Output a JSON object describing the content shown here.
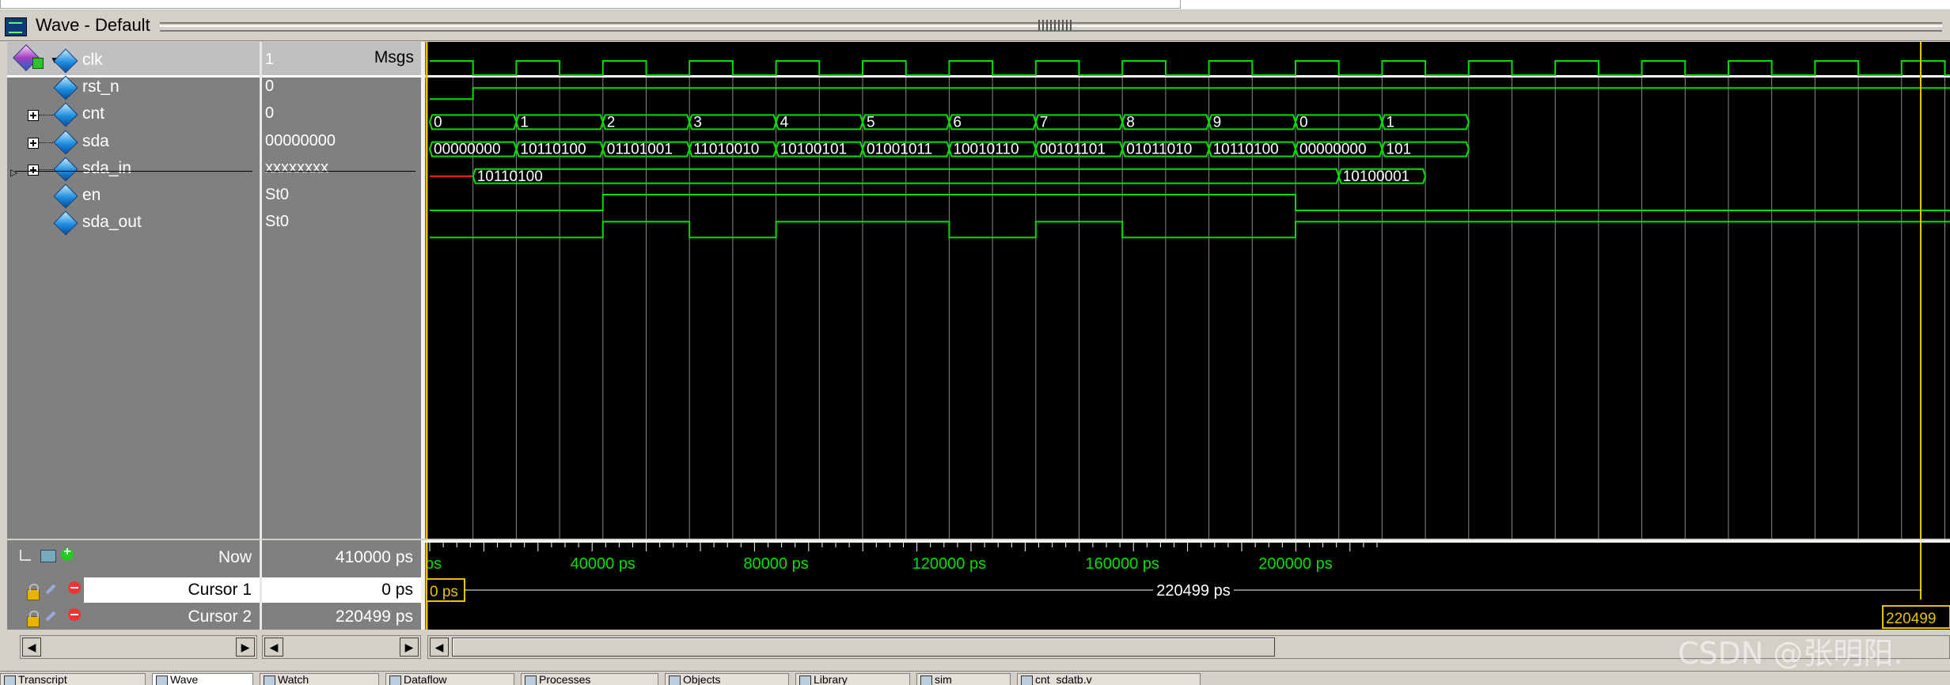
{
  "window": {
    "title": "Wave - Default"
  },
  "columns": {
    "msgs": "Msgs"
  },
  "signals": [
    {
      "name": "clk",
      "value": "1",
      "expandable": false
    },
    {
      "name": "rst_n",
      "value": "0",
      "expandable": false
    },
    {
      "name": "cnt",
      "value": "0",
      "expandable": true
    },
    {
      "name": "sda",
      "value": "00000000",
      "expandable": true
    },
    {
      "name": "sda_in",
      "value": "xxxxxxxx",
      "expandable": true
    },
    {
      "name": "en",
      "value": "St0",
      "expandable": false
    },
    {
      "name": "sda_out",
      "value": "St0",
      "expandable": false
    }
  ],
  "cnt_labels": [
    "0",
    "1",
    "2",
    "3",
    "4",
    "5",
    "6",
    "7",
    "8",
    "9",
    "0",
    "1"
  ],
  "sda_labels": [
    "00000000",
    "10110100",
    "01101001",
    "11010010",
    "10100101",
    "01001011",
    "10010110",
    "00101101",
    "01011010",
    "10110100",
    "00000000",
    "101"
  ],
  "sda_in_labels": [
    "10110100",
    "10100001"
  ],
  "timeline": {
    "start_label": "ps",
    "ticks": [
      "40000 ps",
      "80000 ps",
      "120000 ps",
      "160000 ps",
      "200000 ps"
    ]
  },
  "status": {
    "now_label": "Now",
    "now_value": "410000 ps",
    "cursor1_label": "Cursor 1",
    "cursor1_value": "0 ps",
    "cursor2_label": "Cursor 2",
    "cursor2_value": "220499 ps",
    "cursor1_marker": "0 ps",
    "delta_label": "220499 ps",
    "cursor2_marker": "220499"
  },
  "tabs": [
    "Transcript",
    "Wave",
    "Watch",
    "Dataflow",
    "Processes",
    "Objects",
    "Library",
    "sim",
    "cnt_sdatb.v"
  ],
  "watermark": "CSDN @张明阳.",
  "colors": {
    "wave": "#00e000",
    "grid": "#8a8a8a",
    "cursor": "#e8c000",
    "unknown": "#ff2020"
  }
}
